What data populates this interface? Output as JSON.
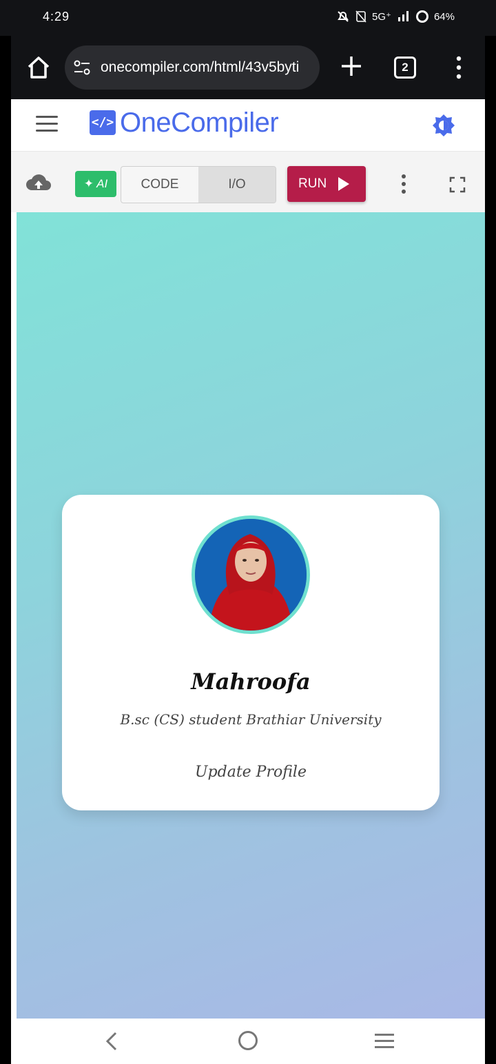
{
  "status_bar": {
    "time": "4:29",
    "network": "5G⁺",
    "battery": "64%"
  },
  "browser": {
    "url": "onecompiler.com/html/43v5byti",
    "tab_count": "2"
  },
  "app": {
    "brand_icon_text": "</>",
    "brand_name": "OneCompiler"
  },
  "toolbar": {
    "ai_label": "AI",
    "code_tab": "CODE",
    "io_tab": "I/O",
    "active_tab": "I/O",
    "run_label": "RUN"
  },
  "profile_card": {
    "name": "Mahroofa",
    "subtitle": "B.sc (CS) student Brathiar University",
    "update_link": "Update Profile"
  },
  "colors": {
    "brand": "#4a6bea",
    "run": "#b51d49",
    "ai": "#2dbd6b",
    "avatar_border": "#6fe0cf"
  },
  "icons": {
    "home": "home-icon",
    "site_info": "tune-icon",
    "new_tab": "plus-icon",
    "browser_menu": "kebab-icon",
    "menu": "hamburger-icon",
    "theme": "brightness-icon",
    "upload": "cloud-upload-icon",
    "run": "play-icon",
    "more": "more-vertical-icon",
    "fullscreen": "fullscreen-icon"
  }
}
